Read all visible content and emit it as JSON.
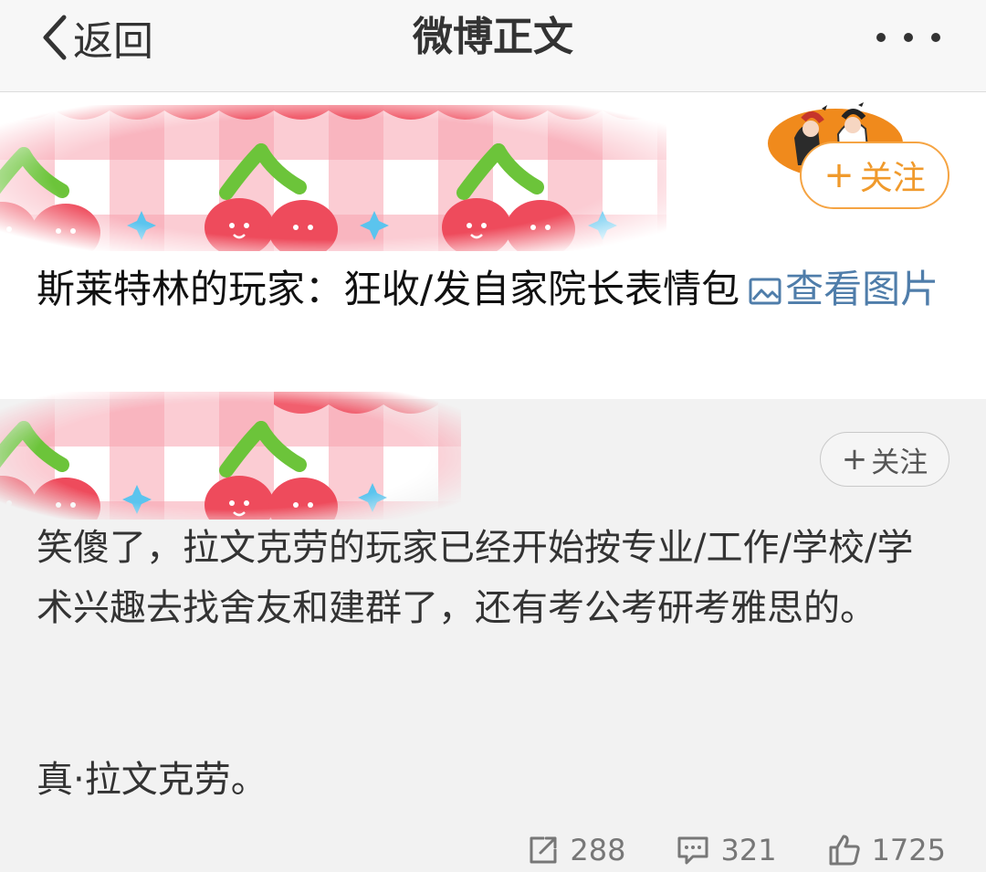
{
  "nav": {
    "back_label": "返回",
    "title": "微博正文",
    "more_icon": "more-dots-icon"
  },
  "post": {
    "follow_label": "关注",
    "text": "斯莱特林的玩家：狂收/发自家院长表情包",
    "pic_link_label": "查看图片",
    "pic_icon": "image-icon"
  },
  "repost": {
    "follow_label": "关注",
    "text": "笑傻了，拉文克劳的玩家已经开始按专业/工作/学校/学术兴趣去找舍友和建群了，还有考公考研考雅思的。",
    "text2": "真·拉文克劳。"
  },
  "actions": {
    "repost_count": "288",
    "comment_count": "321",
    "like_count": "1725"
  },
  "colors": {
    "accent_orange": "#f09a2c",
    "link_blue": "#4f7daa",
    "banner_pink": "#f7a1ae",
    "cherry_red": "#ee4b5c",
    "leaf_green": "#6cc43a"
  }
}
